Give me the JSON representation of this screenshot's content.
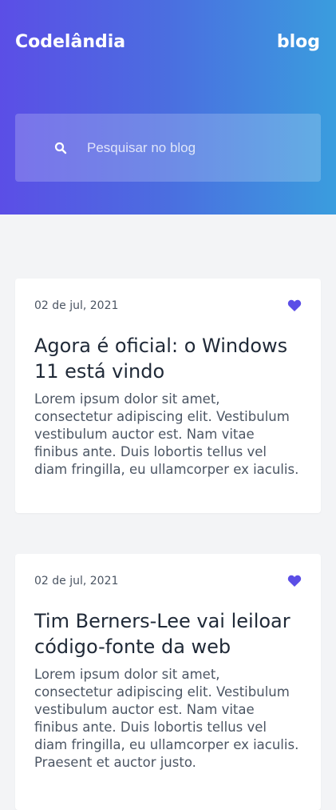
{
  "header": {
    "brand": "Codelândia",
    "page_label": "blog",
    "search": {
      "placeholder": "Pesquisar no blog",
      "value": "",
      "icon": "search-icon"
    }
  },
  "posts": [
    {
      "date": "02 de jul, 2021",
      "title": "Agora é oficial: o Windows 11 está vindo",
      "excerpt": "Lorem ipsum dolor sit amet, consectetur adipiscing elit. Vestibulum vestibulum auctor est. Nam vitae finibus ante. Duis lobortis tellus vel diam fringilla, eu ullamcorper ex iaculis.",
      "icon": "heart-icon"
    },
    {
      "date": "02 de jul, 2021",
      "title": "Tim Berners-Lee vai leiloar código-fonte da web",
      "excerpt": "Lorem ipsum dolor sit amet, consectetur adipiscing elit. Vestibulum vestibulum auctor est. Nam vitae finibus ante. Duis lobortis tellus vel diam fringilla, eu ullamcorper ex iaculis. Praesent et auctor justo.",
      "icon": "heart-icon"
    }
  ],
  "colors": {
    "gradient_start": "#5b4ee6",
    "gradient_end": "#3a9dde",
    "accent": "#5b4ee6",
    "background": "#f3f4f6"
  }
}
